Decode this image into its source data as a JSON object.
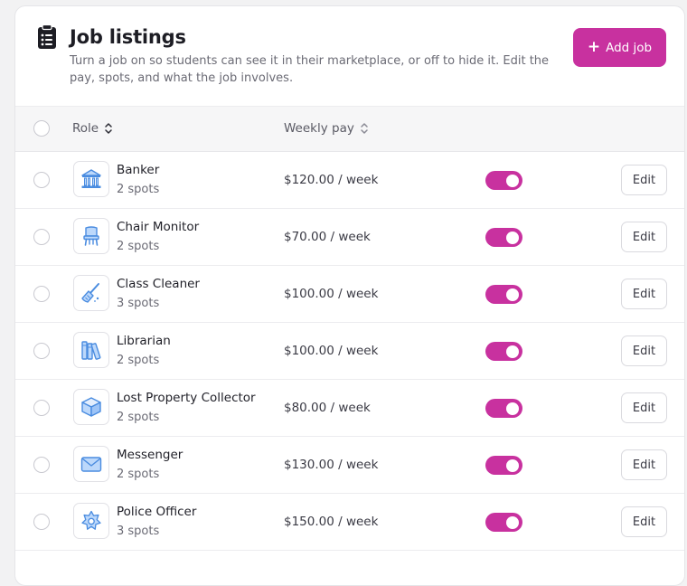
{
  "header": {
    "title": "Job listings",
    "subtitle": "Turn a job on so students can see it in their marketplace, or off to hide it. Edit the pay, spots, and what the job involves.",
    "add_button_label": "Add job",
    "title_icon": "clipboard-list-icon"
  },
  "table": {
    "columns": {
      "role": "Role",
      "weekly_pay": "Weekly pay"
    },
    "rows": [
      {
        "name": "Banker",
        "spots": "2 spots",
        "pay": "$120.00 / week",
        "active": true,
        "icon": "bank-icon",
        "edit_label": "Edit"
      },
      {
        "name": "Chair Monitor",
        "spots": "2 spots",
        "pay": "$70.00 / week",
        "active": true,
        "icon": "chair-icon",
        "edit_label": "Edit"
      },
      {
        "name": "Class Cleaner",
        "spots": "3 spots",
        "pay": "$100.00 / week",
        "active": true,
        "icon": "broom-icon",
        "edit_label": "Edit"
      },
      {
        "name": "Librarian",
        "spots": "2 spots",
        "pay": "$100.00 / week",
        "active": true,
        "icon": "books-icon",
        "edit_label": "Edit"
      },
      {
        "name": "Lost Property Collector",
        "spots": "2 spots",
        "pay": "$80.00 / week",
        "active": true,
        "icon": "box-icon",
        "edit_label": "Edit"
      },
      {
        "name": "Messenger",
        "spots": "2 spots",
        "pay": "$130.00 / week",
        "active": true,
        "icon": "envelope-icon",
        "edit_label": "Edit"
      },
      {
        "name": "Police Officer",
        "spots": "3 spots",
        "pay": "$150.00 / week",
        "active": true,
        "icon": "police-badge-icon",
        "edit_label": "Edit"
      }
    ]
  },
  "colors": {
    "accent": "#c8319f",
    "icon_stroke": "#4a8ce0",
    "icon_fill": "#bcd8fb"
  }
}
